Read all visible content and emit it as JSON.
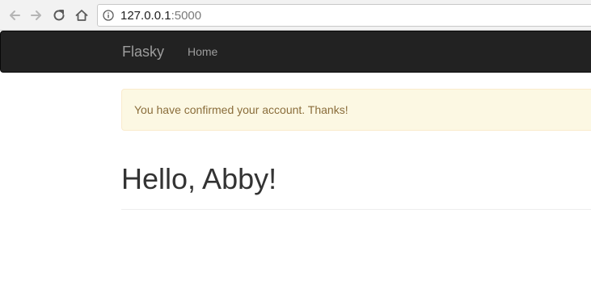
{
  "browser": {
    "url_host": "127.0.0.1",
    "url_port": ":5000"
  },
  "navbar": {
    "brand": "Flasky",
    "home_label": "Home"
  },
  "alert": {
    "message": "You have confirmed your account. Thanks!"
  },
  "page": {
    "title": "Hello, Abby!"
  },
  "colors": {
    "navbar_bg": "#222222",
    "navbar_text": "#9d9d9d",
    "alert_bg": "#fcf8e3",
    "alert_text": "#8a6d3b",
    "title_text": "#333333"
  },
  "icons": {
    "back": "arrow-left-icon",
    "forward": "arrow-right-icon",
    "reload": "reload-icon",
    "home": "home-icon",
    "site_info": "info-icon"
  }
}
